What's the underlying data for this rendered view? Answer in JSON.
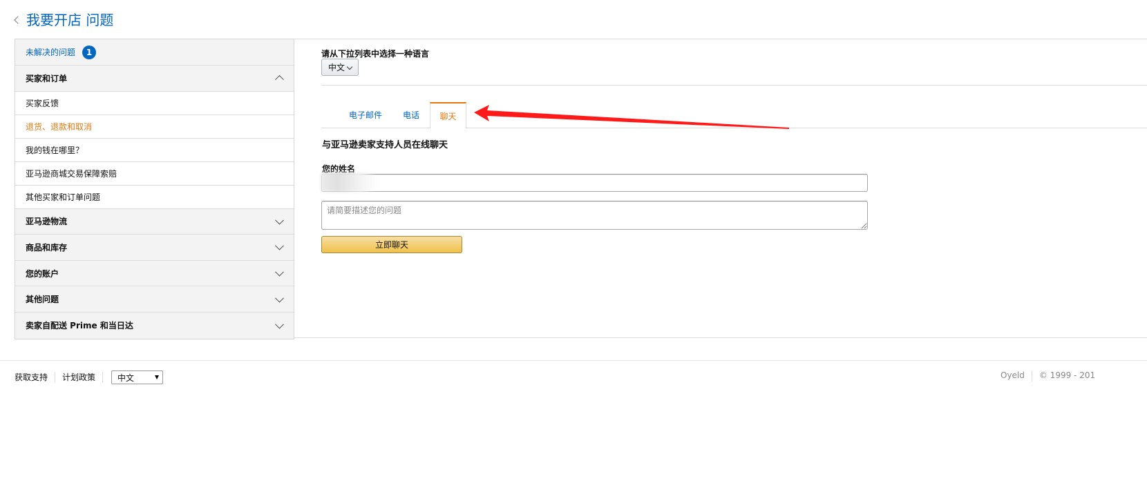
{
  "header": {
    "title": "我要开店 问题"
  },
  "sidebar": {
    "unresolved": {
      "label": "未解决的问题",
      "badge": "1"
    },
    "section_buyers": {
      "label": "买家和订单"
    },
    "items": [
      {
        "label": "买家反馈"
      },
      {
        "label": "退货、退款和取消"
      },
      {
        "label": "我的钱在哪里？"
      },
      {
        "label": "亚马逊商城交易保障索赔"
      },
      {
        "label": "其他买家和订单问题"
      }
    ],
    "sections": [
      {
        "label": "亚马逊物流"
      },
      {
        "label": "商品和库存"
      },
      {
        "label": "您的账户"
      },
      {
        "label": "其他问题"
      },
      {
        "label": "卖家自配送 Prime 和当日达"
      }
    ]
  },
  "main": {
    "language_label": "请从下拉列表中选择一种语言",
    "language_value": "中文",
    "tabs": [
      {
        "label": "电子邮件"
      },
      {
        "label": "电话"
      },
      {
        "label": "聊天"
      }
    ],
    "chat_title": "与亚马逊卖家支持人员在线聊天",
    "name_label": "您的姓名",
    "description_placeholder": "请简要描述您的问题",
    "chat_button": "立即聊天"
  },
  "footer": {
    "links": [
      {
        "label": "获取支持"
      },
      {
        "label": "计划政策"
      }
    ],
    "language_value": "中文",
    "right_name": "Oyeld",
    "copyright": "© 1999 - 201"
  },
  "colors": {
    "link": "#0066c0",
    "active": "#e47911",
    "annotation_arrow": "#ff1a1a",
    "button": "#f0c14b"
  }
}
